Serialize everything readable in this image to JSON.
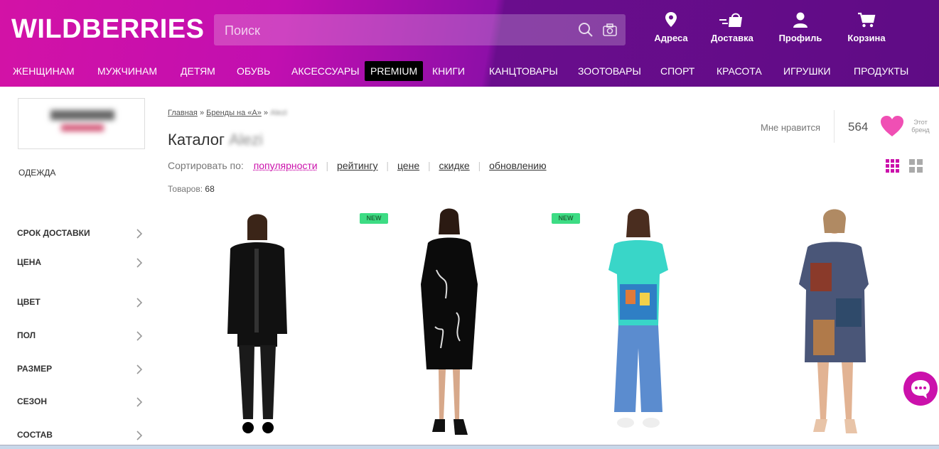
{
  "header": {
    "logo": "WILDBERRIES",
    "search_placeholder": "Поиск",
    "actions": [
      {
        "label": "Адреса",
        "icon": "location-pin-icon"
      },
      {
        "label": "Доставка",
        "icon": "delivery-icon"
      },
      {
        "label": "Профиль",
        "icon": "profile-icon"
      },
      {
        "label": "Корзина",
        "icon": "cart-icon"
      }
    ]
  },
  "nav": [
    "ЖЕНЩИНАМ",
    "МУЖЧИНАМ",
    "ДЕТЯМ",
    "ОБУВЬ",
    "АКСЕССУАРЫ",
    "PREMIUM",
    "КНИГИ",
    "КАНЦТОВАРЫ",
    "ЗООТОВАРЫ",
    "СПОРТ",
    "КРАСОТА",
    "ИГРУШКИ",
    "ПРОДУКТЫ"
  ],
  "sidebar": {
    "category": "ОДЕЖДА",
    "filters": [
      "СРОК ДОСТАВКИ",
      "ЦЕНА",
      "ЦВЕТ",
      "ПОЛ",
      "РАЗМЕР",
      "СЕЗОН",
      "СОСТАВ"
    ]
  },
  "breadcrumbs": {
    "home": "Главная",
    "sep": "»",
    "brands": "Бренды на «А»",
    "current": "Alezi"
  },
  "page_title": {
    "text": "Каталог",
    "brand": "Alezi"
  },
  "sort": {
    "label": "Сортировать по:",
    "options": [
      "популярности",
      "рейтингу",
      "цене",
      "скидке",
      "обновлению"
    ],
    "active": "популярности"
  },
  "count": {
    "label": "Товаров:",
    "value": "68"
  },
  "likes": {
    "label": "Мне нравится",
    "count": "564",
    "brand_line1": "Этот",
    "brand_line2": "бренд"
  },
  "badges": {
    "new": "NEW"
  },
  "colors": {
    "accent": "#cb11ab",
    "header_pink": "#d312a6",
    "header_purple": "#5f0c85",
    "new_badge": "#3ddc84"
  }
}
